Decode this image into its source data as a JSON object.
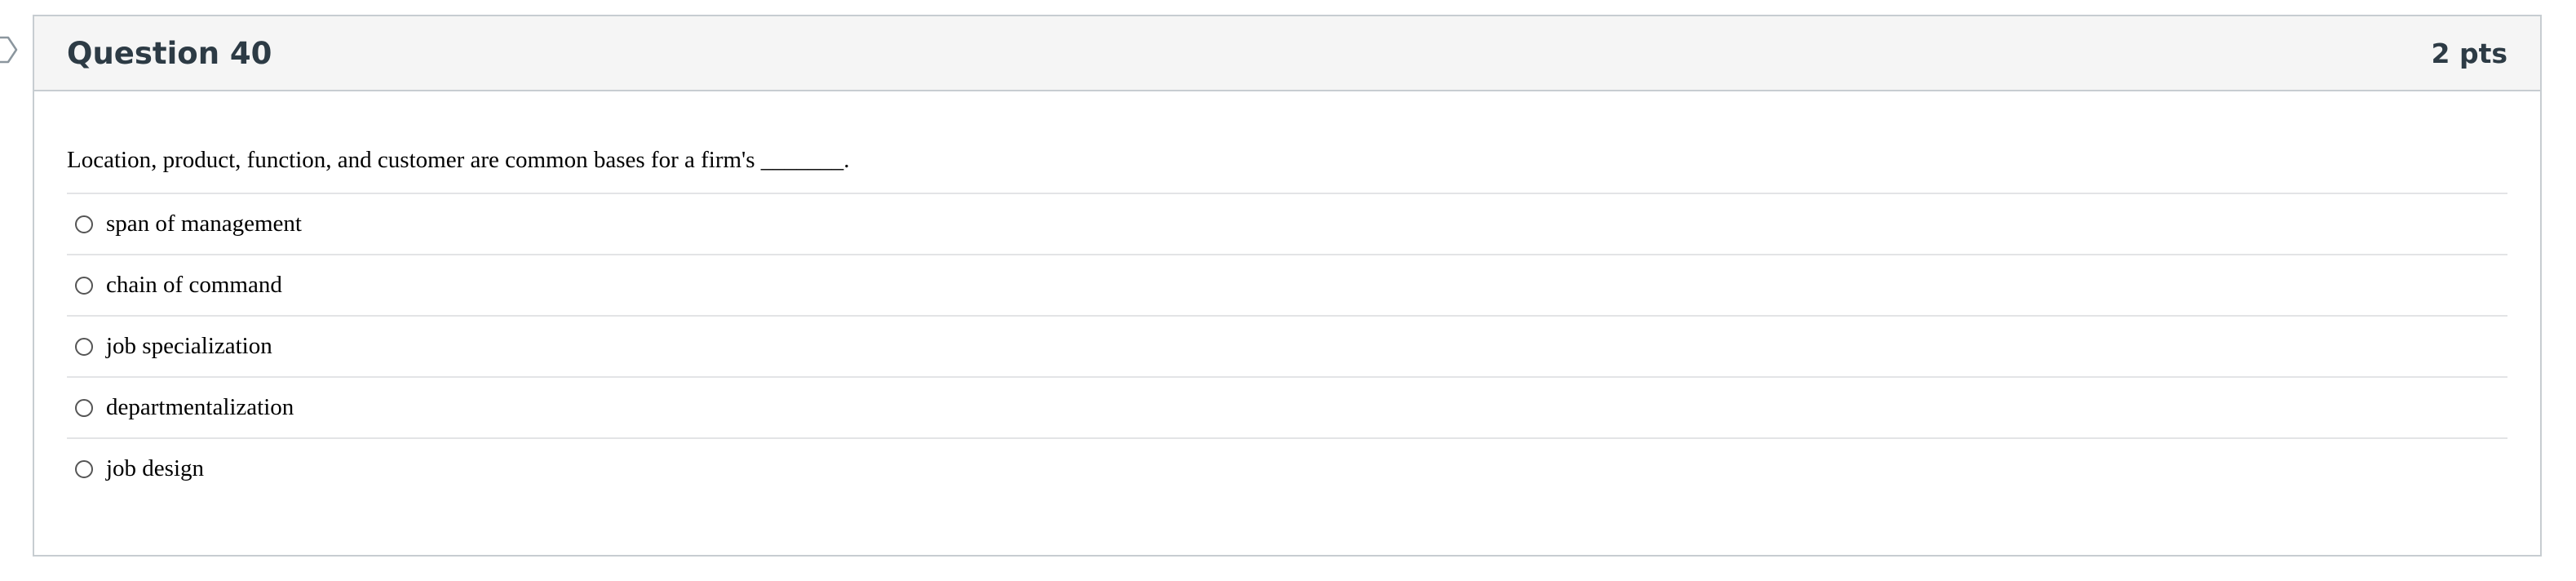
{
  "question": {
    "title": "Question 40",
    "points": "2 pts",
    "text": "Location, product, function, and customer are common bases for a firm's _______.",
    "answers": [
      {
        "label": "span of management",
        "selected": false
      },
      {
        "label": "chain of command",
        "selected": false
      },
      {
        "label": "job specialization",
        "selected": false
      },
      {
        "label": "departmentalization",
        "selected": false
      },
      {
        "label": "job design",
        "selected": false
      }
    ]
  },
  "colors": {
    "header_background": "#f5f5f5",
    "border": "#c7cdd1",
    "title_text": "#2d3b45",
    "divider": "#e3e4e6"
  },
  "icons": {
    "flag": "bookmark-flag-icon",
    "option": "radio-button-icon"
  }
}
